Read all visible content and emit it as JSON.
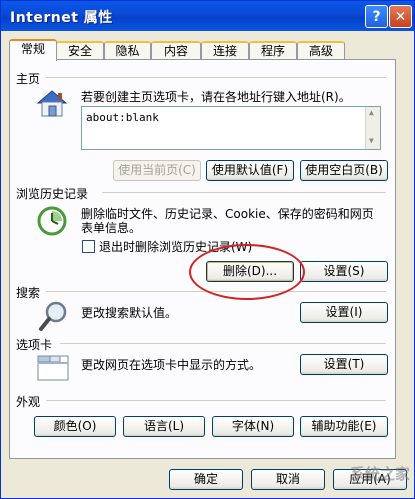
{
  "window": {
    "title": "Internet 属性"
  },
  "title_buttons": {
    "help": "?",
    "close": "✕"
  },
  "tabs": [
    {
      "label": "常规"
    },
    {
      "label": "安全"
    },
    {
      "label": "隐私"
    },
    {
      "label": "内容"
    },
    {
      "label": "连接"
    },
    {
      "label": "程序"
    },
    {
      "label": "高级"
    }
  ],
  "home": {
    "heading": "主页",
    "description": "若要创建主页选项卡，请在各地址行键入地址(R)。",
    "url_value": "about:blank",
    "use_current": "使用当前页(C)",
    "use_default": "使用默认值(F)",
    "use_blank": "使用空白页(B)"
  },
  "history": {
    "heading": "浏览历史记录",
    "description_line1": "删除临时文件、历史记录、Cookie、保存的密码和网页",
    "description_line2": "表单信息。",
    "delete_on_exit": "退出时删除浏览历史记录(W)",
    "delete_button": "删除(D)...",
    "settings_button": "设置(S)"
  },
  "search": {
    "heading": "搜索",
    "description": "更改搜索默认值。",
    "settings_button": "设置(I)"
  },
  "tabs_section": {
    "heading": "选项卡",
    "description": "更改网页在选项卡中显示的方式。",
    "settings_button": "设置(T)"
  },
  "appearance": {
    "heading": "外观",
    "colors": "颜色(O)",
    "languages": "语言(L)",
    "fonts": "字体(N)",
    "accessibility": "辅助功能(E)"
  },
  "footer": {
    "ok": "确定",
    "cancel": "取消",
    "apply": "应用(A)"
  },
  "watermark": "系统之家",
  "colors": {
    "annotation_oval": "#d62020",
    "title_bar": "#0a49d6"
  }
}
